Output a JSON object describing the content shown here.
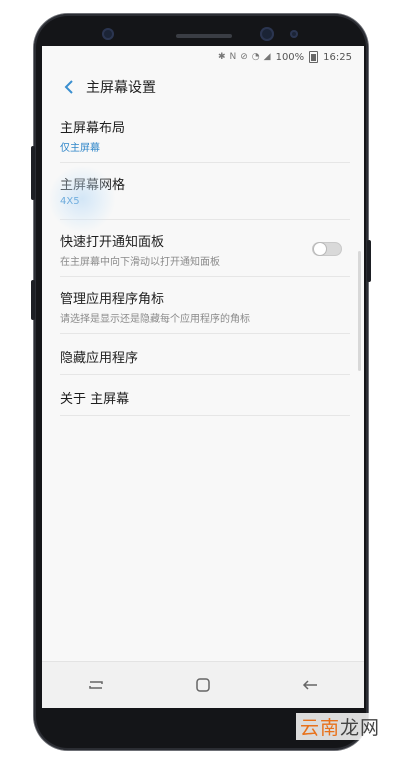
{
  "status_bar": {
    "icons": [
      "bluetooth-icon",
      "nfc-icon",
      "mute-icon",
      "wifi-icon",
      "signal-icon"
    ],
    "battery": "100%",
    "time": "16:25"
  },
  "header": {
    "title": "主屏幕设置"
  },
  "settings": {
    "items": [
      {
        "title": "主屏幕布局",
        "subtitle": "仅主屏幕"
      },
      {
        "title": "主屏幕网格",
        "subtitle": "4X5"
      },
      {
        "title": "快速打开通知面板",
        "subtitle": "在主屏幕中向下滑动以打开通知面板",
        "toggle": false
      },
      {
        "title": "管理应用程序角标",
        "subtitle": "请选择是显示还是隐藏每个应用程序的角标"
      },
      {
        "title": "隐藏应用程序"
      },
      {
        "title": "关于 主屏幕"
      }
    ]
  },
  "nav_bar": {
    "buttons": [
      "recents-icon",
      "home-icon",
      "back-icon"
    ]
  },
  "watermark": {
    "brand": "云南",
    "suffix": "龙网"
  },
  "colors": {
    "accent": "#2f86c9",
    "phone_frame": "#141518",
    "screen_bg": "#f8f8f8"
  }
}
